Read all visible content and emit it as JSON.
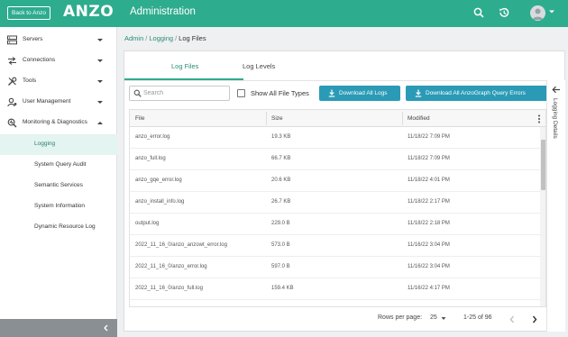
{
  "header": {
    "back_label": "Back to Anzo",
    "logo_text": "ANZO",
    "app_title": "Administration",
    "brand_color": "#2eac8e",
    "icons": [
      "search-icon",
      "history-icon",
      "avatar",
      "chevron-down-icon"
    ]
  },
  "sidebar": {
    "items": [
      {
        "label": "Servers",
        "icon": "servers-icon",
        "expanded": false
      },
      {
        "label": "Connections",
        "icon": "connections-icon",
        "expanded": false
      },
      {
        "label": "Tools",
        "icon": "tools-icon",
        "expanded": false
      },
      {
        "label": "User Management",
        "icon": "user-management-icon",
        "expanded": false
      },
      {
        "label": "Monitoring & Diagnostics",
        "icon": "monitoring-icon",
        "expanded": true
      }
    ],
    "subitems": [
      {
        "label": "Logging",
        "active": true
      },
      {
        "label": "System Query Audit",
        "active": false
      },
      {
        "label": "Semantic Services",
        "active": false
      },
      {
        "label": "System Information",
        "active": false
      },
      {
        "label": "Dynamic Resource Log",
        "active": false
      }
    ]
  },
  "breadcrumb": {
    "admin": "Admin",
    "logging": "Logging",
    "current": "Log Files",
    "separator": "/"
  },
  "tabs": [
    {
      "label": "Log Files",
      "active": true
    },
    {
      "label": "Log Levels",
      "active": false
    }
  ],
  "toolbar": {
    "search_placeholder": "Search",
    "show_all_label": "Show All File Types",
    "download_all_label": "Download All Logs",
    "download_anzograph_label": "Download All AnzoGraph Query Errors"
  },
  "table": {
    "columns": [
      "File",
      "Size",
      "Modified"
    ],
    "rows": [
      [
        "anzo_error.log",
        "19.3 KB",
        "11/18/22 7:09 PM"
      ],
      [
        "anzo_full.log",
        "66.7 KB",
        "11/18/22 7:09 PM"
      ],
      [
        "anzo_gqe_error.log",
        "20.6 KB",
        "11/18/22 4:01 PM"
      ],
      [
        "anzo_install_info.log",
        "26.7 KB",
        "11/18/22 2:17 PM"
      ],
      [
        "output.log",
        "229.0 B",
        "11/18/22 2:18 PM"
      ],
      [
        "2022_11_16_0/anzo_anzowt_error.log",
        "573.0 B",
        "11/16/22 3:04 PM"
      ],
      [
        "2022_11_16_0/anzo_error.log",
        "597.0 B",
        "11/16/22 3:04 PM"
      ],
      [
        "2022_11_16_0/anzo_full.log",
        "159.4 KB",
        "11/16/22 4:17 PM"
      ]
    ]
  },
  "pager": {
    "rows_per_page_label": "Rows per page:",
    "rows_per_page_value": "25",
    "range": "1-25 of 96"
  },
  "details_panel": {
    "title": "Logging Details"
  }
}
